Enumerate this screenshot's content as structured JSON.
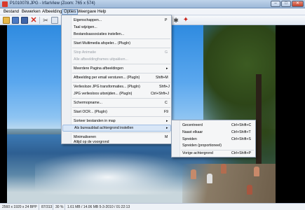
{
  "window": {
    "title": "P1010078.JPG - IrfanView (Zoom: 765 x 574)",
    "min": "–",
    "max": "□",
    "close": "✕"
  },
  "menubar": {
    "items": [
      "Bestand",
      "Bewerken",
      "Afbeelding",
      "Opties",
      "Weergave",
      "Help"
    ],
    "active": "Opties"
  },
  "toolbar": {
    "icons": [
      "open-folder-icon",
      "save-icon",
      "save-as-icon",
      "delete-icon",
      "cut-icon",
      "copy-icon",
      "settings-icon",
      "irfanview-cat-icon"
    ]
  },
  "options_menu": {
    "items": [
      {
        "label": "Eigenschappen...",
        "shortcut": "P",
        "enabled": true
      },
      {
        "label": "Taal wijzigen...",
        "shortcut": "",
        "enabled": true
      },
      {
        "label": "Bestandsassociaties instellen...",
        "shortcut": "",
        "enabled": true
      },
      {
        "label": "Start Multimedia afspeler... (PlugIn)",
        "shortcut": "",
        "enabled": true
      },
      {
        "label": "Stop Animatie",
        "shortcut": "G",
        "enabled": false
      },
      {
        "label": "Alle afbeeldingframes uitpakken...",
        "shortcut": "",
        "enabled": false
      },
      {
        "label": "Meerdere Pagina afbeeldingen",
        "shortcut": "",
        "enabled": true,
        "submenu": true
      },
      {
        "label": "Afbeelding per email versturen... (PlugIn)",
        "shortcut": "Shift+M",
        "enabled": true
      },
      {
        "label": "Verliesloze JPG transformaties... (PlugIn)",
        "shortcut": "Shft+J",
        "enabled": true
      },
      {
        "label": "JPG verliesloos uitsnijden... (PlugIn)",
        "shortcut": "Ctrl+Shft+J",
        "enabled": true
      },
      {
        "label": "Schermopname...",
        "shortcut": "C",
        "enabled": true
      },
      {
        "label": "Start OCR... (PlugIn)",
        "shortcut": "F9",
        "enabled": true
      },
      {
        "label": "Sorteer bestanden in map",
        "shortcut": "",
        "enabled": true,
        "submenu": true
      },
      {
        "label": "Als bureaublad achtergrond instellen",
        "shortcut": "",
        "enabled": true,
        "submenu": true,
        "highlighted": true
      },
      {
        "label": "Minimaliseren",
        "shortcut": "M",
        "enabled": true
      },
      {
        "label": "Altijd op de voorgrond",
        "shortcut": "",
        "enabled": true
      }
    ]
  },
  "wallpaper_submenu": {
    "items": [
      {
        "label": "Gecentreerd",
        "shortcut": "Ctrl+Shift+C"
      },
      {
        "label": "Naast elkaar",
        "shortcut": "Ctrl+Shift+T"
      },
      {
        "label": "Spreiden",
        "shortcut": "Ctrl+Shift+S"
      },
      {
        "label": "Spreiden (proportioneel)",
        "shortcut": ""
      },
      {
        "label": "Vorige achtergrond",
        "shortcut": "Ctrl+Shift+P"
      }
    ]
  },
  "statusbar": {
    "resolution": "2560 x 1920 x 24 BPP",
    "index": "87/313",
    "zoom": "30 %",
    "info": "1.61 MB / 14.06 MB  5-3-2010 / 01:22:13"
  }
}
